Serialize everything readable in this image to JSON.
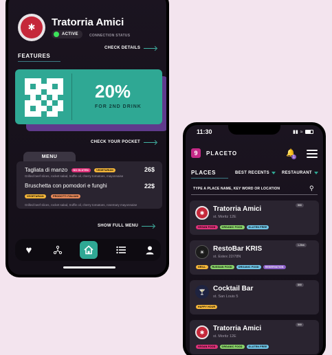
{
  "colors": {
    "background": "#f3e4ee",
    "accent_teal": "#2fa894",
    "accent_purple": "#5f3a8c",
    "brand_pink": "#c42a87",
    "active_green": "#3ce35a"
  },
  "left_phone": {
    "restaurant_name": "Tratorria Amici",
    "status_label": "ACTIVE",
    "status_caption": "CONNECTION STATUS",
    "check_details": "CHECK DETAILS",
    "features_label": "FEATURES",
    "promo": {
      "value": "20%",
      "caption": "FOR 2ND DRINK"
    },
    "check_pocket": "CHECK YOUR POCKET",
    "menu_label": "MENU",
    "menu_items": [
      {
        "name": "Tagliata di manzo",
        "description": "Grilled beef slices, rocket salad, truffle oil, cherry tomatoes, mayonnaise",
        "price": "26$",
        "tags": [
          {
            "label": "NO GLUTEN",
            "color": "#e0327a"
          },
          {
            "label": "VEGETARIAN",
            "color": "#f4b63a"
          }
        ]
      },
      {
        "name": "Bruschetta con pomodori e funghi",
        "description": "Grilled beef slices, rocket salad, truffle oil, cherry tomatoes, rosemary mayonnaise",
        "price": "22$",
        "tags": [
          {
            "label": "VEGETARIAN",
            "color": "#f4b63a"
          },
          {
            "label": "PRODOTTI ITALIANI",
            "color": "#e8895a"
          }
        ]
      }
    ],
    "show_full_menu": "SHOW FULL MENU",
    "tabs": [
      "heart-icon",
      "share-icon",
      "home-icon",
      "list-icon",
      "user-icon"
    ]
  },
  "right_phone": {
    "time": "11:30",
    "brand": "PLACETO",
    "notification_count": "1",
    "places_label": "PLACES",
    "filter_sort": "BEST RECENTS",
    "filter_type": "RESTAURANT",
    "search_placeholder": "TYPE A PLACE NAME, KEY WORD OR LOCATION",
    "venues": [
      {
        "name": "Tratorria Amici",
        "address": "st. Moritz 12E",
        "distance": "500",
        "logo_color": "#c5283a",
        "tags": [
          {
            "label": "VEGAN FOOD",
            "color": "#e0327a"
          },
          {
            "label": "ORGANIC FOOD",
            "color": "#8bd46b"
          },
          {
            "label": "GLUTEN FREE",
            "color": "#6fc6e8"
          }
        ]
      },
      {
        "name": "RestoBar KRIS",
        "address": "st. Estex 22/78N",
        "distance": "1.2km",
        "logo_color": "#1b1b1b",
        "tags": [
          {
            "label": "GRILL",
            "color": "#f4b63a"
          },
          {
            "label": "RUSSIAN FOOD",
            "color": "#8bd46b"
          },
          {
            "label": "ORGANIC FOOD",
            "color": "#6fc6e8"
          },
          {
            "label": "RESERVATION",
            "color": "#8b5fc7"
          }
        ]
      },
      {
        "name": "Cocktail Bar",
        "address": "st. San Louis 5",
        "distance": "800",
        "logo_color": "#1e2340",
        "tags": [
          {
            "label": "HAPPY HOUR",
            "color": "#f4b63a"
          }
        ]
      },
      {
        "name": "Tratorria Amici",
        "address": "st. Moritz 12E",
        "distance": "500",
        "logo_color": "#c5283a",
        "tags": [
          {
            "label": "VEGAN FOOD",
            "color": "#e0327a"
          },
          {
            "label": "ORGANIC FOOD",
            "color": "#8bd46b"
          },
          {
            "label": "GLUTEN FREE",
            "color": "#6fc6e8"
          }
        ]
      }
    ]
  }
}
